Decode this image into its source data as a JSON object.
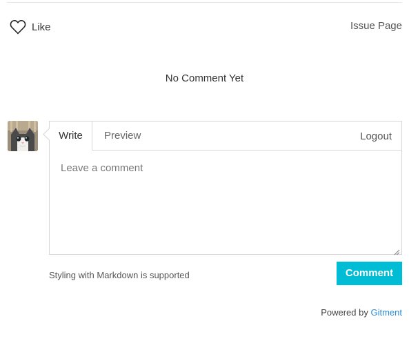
{
  "actions": {
    "like_label": "Like",
    "issue_page_label": "Issue Page"
  },
  "status": {
    "empty_message": "No Comment Yet"
  },
  "editor": {
    "tabs": [
      {
        "label": "Write",
        "active": true
      },
      {
        "label": "Preview",
        "active": false
      }
    ],
    "logout_label": "Logout",
    "placeholder": "Leave a comment"
  },
  "footer": {
    "markdown_hint": "Styling with Markdown is supported",
    "submit_label": "Comment",
    "powered_by_text": "Powered by",
    "powered_by_link": "Gitment"
  },
  "colors": {
    "accent": "#00bcd4",
    "link": "#2c8cd6",
    "border": "#d6d6d6"
  },
  "icons": {
    "like": "heart-outline-icon",
    "avatar": "cat-avatar"
  }
}
